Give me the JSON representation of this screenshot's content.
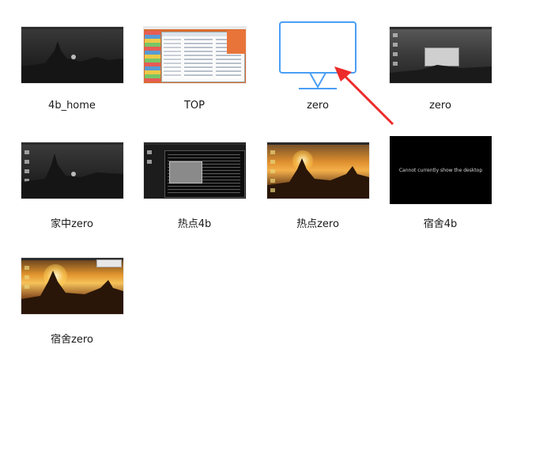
{
  "items": [
    {
      "label": "4b_home"
    },
    {
      "label": "TOP"
    },
    {
      "label": "zero"
    },
    {
      "label": "zero"
    },
    {
      "label": "家中zero"
    },
    {
      "label": "热点4b"
    },
    {
      "label": "热点zero"
    },
    {
      "label": "宿舍4b",
      "thumb_text": "Cannot currently show the desktop"
    },
    {
      "label": "宿舍zero"
    }
  ],
  "colors": {
    "monitor_icon": "#4a9ff5",
    "annotation_arrow": "#ee2b2b",
    "dark_desktop": "#2a2a2a",
    "sunset": "#f0a030"
  },
  "icons": {
    "placeholder_thumbnail": "monitor-icon",
    "annotation": "red-arrow"
  }
}
